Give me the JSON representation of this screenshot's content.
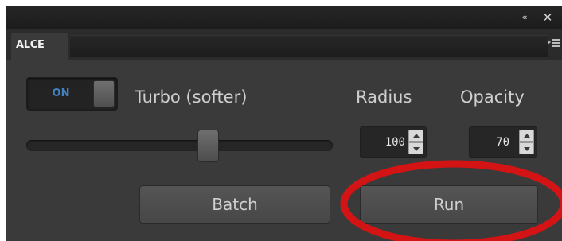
{
  "panel": {
    "collapse_glyph": "«",
    "close_glyph": "✕",
    "tab_label": "ALCE"
  },
  "controls": {
    "toggle_label": "ON",
    "turbo_label": "Turbo (softer)",
    "radius_label": "Radius",
    "opacity_label": "Opacity",
    "radius_value": "100",
    "opacity_value": "70",
    "slider_value_fraction": 0.6
  },
  "buttons": {
    "batch_label": "Batch",
    "run_label": "Run"
  },
  "colors": {
    "panel_bg": "#3a3a3a",
    "toggle_on_text": "#3d83c4",
    "annotation_circle": "#d41414"
  }
}
